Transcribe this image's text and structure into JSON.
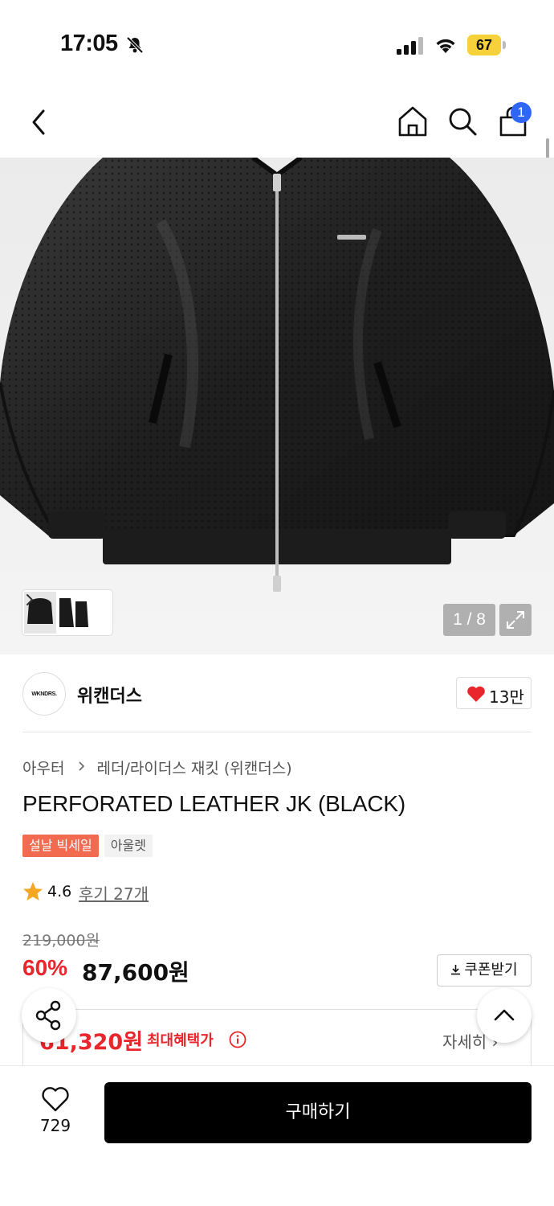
{
  "status_bar": {
    "time": "17:05",
    "battery": "67"
  },
  "nav": {
    "cart_count": "1"
  },
  "gallery": {
    "counter": "1 / 8"
  },
  "brand": {
    "logo_text": "WKNDRS.",
    "name": "위캔더스",
    "like_count": "13만"
  },
  "breadcrumb": {
    "category": "아우터",
    "subcategory": "레더/라이더스 재킷 (위캔더스)"
  },
  "product": {
    "title": "PERFORATED LEATHER JK (BLACK)",
    "badges": [
      "설날 빅세일",
      "아울렛"
    ],
    "rating": "4.6",
    "review_link": "후기 27개",
    "original_price": "219,000원",
    "discount": "60%",
    "sale_price": "87,600원",
    "coupon_label": "쿠폰받기"
  },
  "benefit": {
    "price": "61,320원",
    "label": "최대혜택가",
    "detail": "자세히 ›"
  },
  "bottom_bar": {
    "wish_count": "729",
    "buy_label": "구매하기"
  },
  "colors": {
    "accent_red": "#e8262b",
    "sale_badge": "#f26a50",
    "cart_badge": "#2f66f5",
    "battery": "#f6d13a"
  }
}
